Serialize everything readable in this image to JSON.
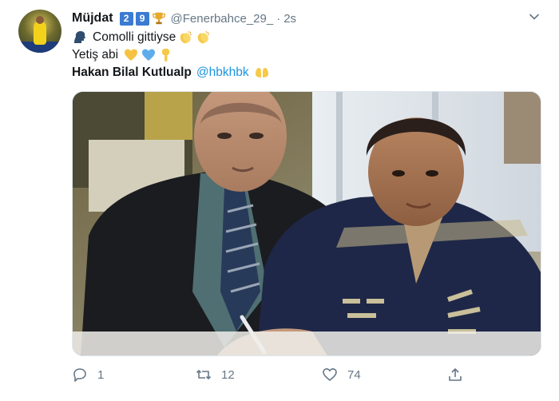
{
  "tweet": {
    "display_name": "Müjdat",
    "badges": [
      "2",
      "9"
    ],
    "handle": "@Fenerbahce_29_",
    "separator": "·",
    "time": "2s",
    "lines": {
      "line1": "Comolli gittiyse",
      "line2": "Yetiş abi",
      "line3_name": "Hakan Bilal Kutlualp",
      "line3_mention": "@hbkhbk"
    },
    "emoji": {
      "speaking_head": "speaking-head-icon",
      "clap": "clapping-hands-icon",
      "yellow_heart": "yellow-heart-icon",
      "blue_heart": "blue-heart-icon",
      "point_down": "pointing-down-icon",
      "open_hands": "open-hands-icon",
      "trophy": "trophy-icon"
    },
    "stats": {
      "replies": "1",
      "retweets": "12",
      "likes": "74"
    }
  },
  "colors": {
    "text": "#14171a",
    "secondary": "#657786",
    "link": "#1b95e0",
    "badge": "#3b7bd1"
  }
}
